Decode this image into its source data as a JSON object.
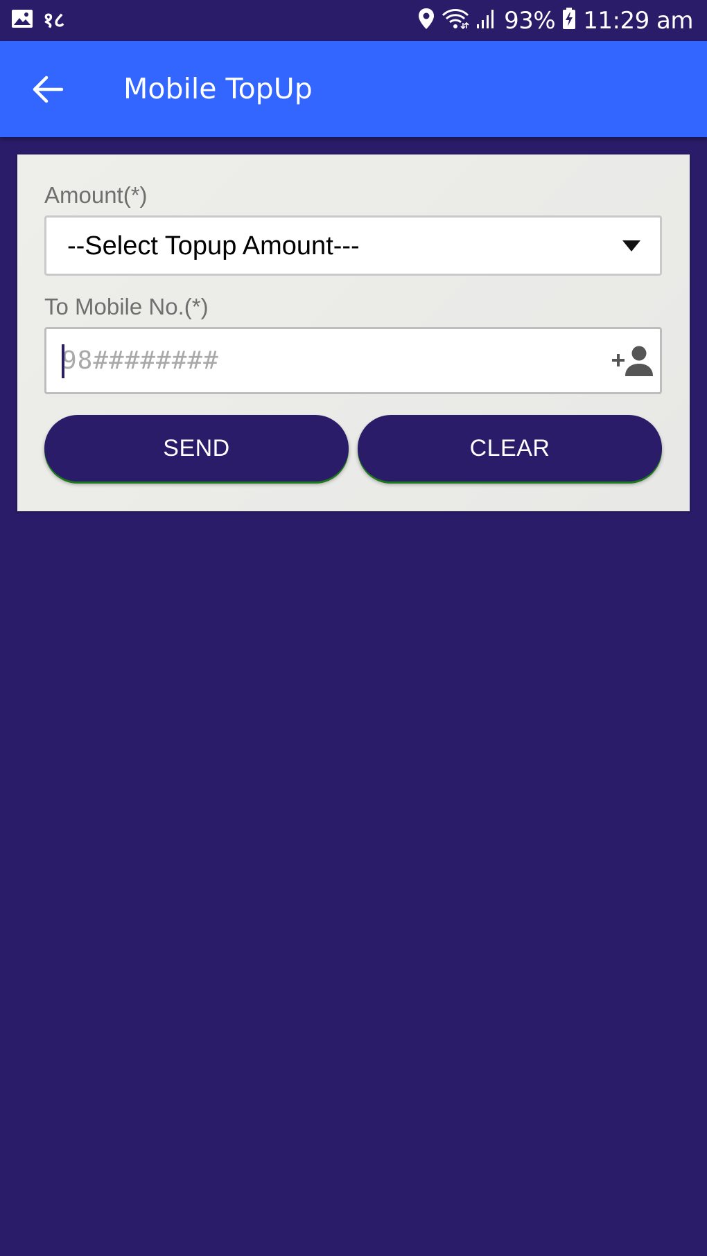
{
  "status_bar": {
    "icons": [
      "gallery-icon",
      "notification-script-icon",
      "location-icon",
      "wifi-icon",
      "signal-icon",
      "battery-charging-icon"
    ],
    "notification_glyph": "१८",
    "battery_percent": "93%",
    "time": "11:29 am"
  },
  "app_bar": {
    "back_icon": "arrow-left-icon",
    "title": "Mobile TopUp",
    "color": "#3366ff"
  },
  "form": {
    "amount_label": "Amount(*)",
    "amount_select_value": "--Select Topup Amount---",
    "mobile_label": "To Mobile No.(*)",
    "mobile_value": "",
    "mobile_placeholder": "98########",
    "add_contact_icon": "add-person-icon",
    "send_label": "SEND",
    "clear_label": "CLEAR"
  },
  "colors": {
    "background": "#2a1c68",
    "card": "#ebebe8",
    "button": "#2a1c68",
    "button_shadow": "#1c7a1c"
  }
}
